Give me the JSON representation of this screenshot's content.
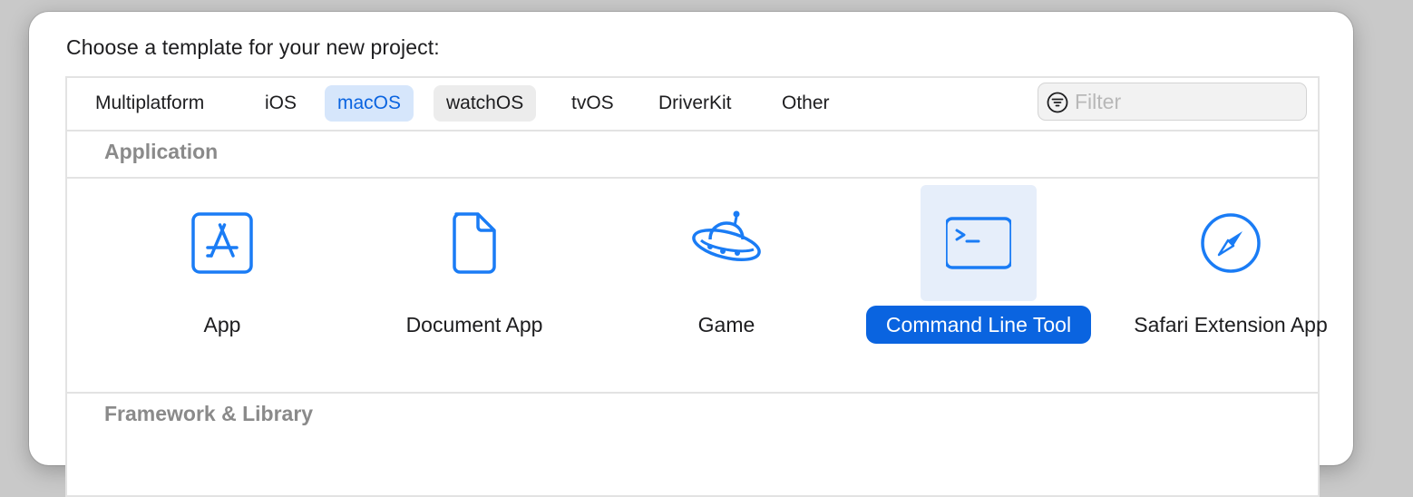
{
  "window": {
    "prompt": "Choose a template for your new project:"
  },
  "platform_tabs": [
    {
      "label": "Multiplatform",
      "state": "normal"
    },
    {
      "label": "iOS",
      "state": "normal"
    },
    {
      "label": "macOS",
      "state": "selected"
    },
    {
      "label": "watchOS",
      "state": "hover"
    },
    {
      "label": "tvOS",
      "state": "normal"
    },
    {
      "label": "DriverKit",
      "state": "normal"
    },
    {
      "label": "Other",
      "state": "normal"
    }
  ],
  "filter": {
    "placeholder": "Filter",
    "value": "",
    "icon": "filter-icon"
  },
  "sections": [
    {
      "title": "Application",
      "templates": [
        {
          "label": "App",
          "icon": "app-store-icon",
          "selected": false
        },
        {
          "label": "Document App",
          "icon": "document-icon",
          "selected": false
        },
        {
          "label": "Game",
          "icon": "game-ufo-icon",
          "selected": false
        },
        {
          "label": "Command Line Tool",
          "icon": "terminal-icon",
          "selected": true
        },
        {
          "label": "Safari Extension App",
          "icon": "safari-compass-icon",
          "selected": false
        }
      ]
    },
    {
      "title": "Framework & Library"
    }
  ],
  "colors": {
    "accent": "#0a64e0",
    "selected_tab_bg": "#d6e6fb",
    "selected_icon_bg": "#e6eefa",
    "icon_blue": "#1a7cf5",
    "section_header_text": "#8a8a8a"
  }
}
